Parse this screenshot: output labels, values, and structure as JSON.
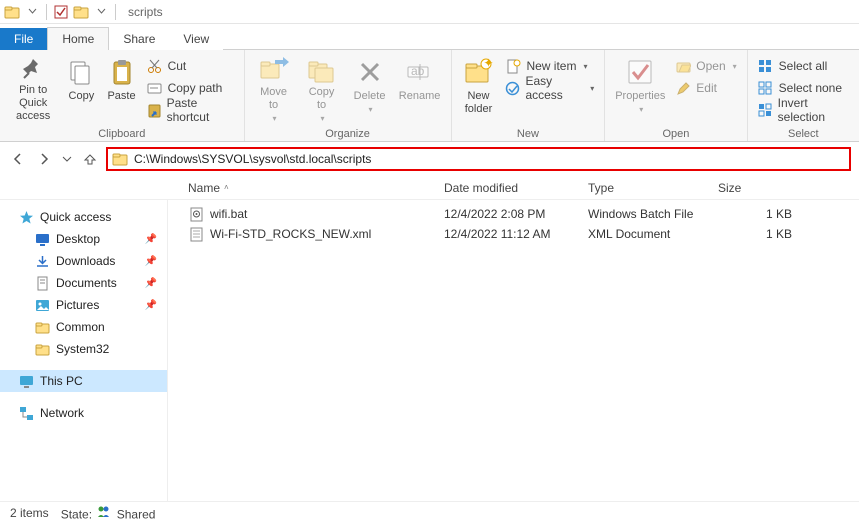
{
  "titlebar": {
    "title": "scripts"
  },
  "tabs": {
    "file": "File",
    "home": "Home",
    "share": "Share",
    "view": "View"
  },
  "ribbon": {
    "clipboard": {
      "label": "Clipboard",
      "pin": "Pin to Quick\naccess",
      "copy": "Copy",
      "paste": "Paste",
      "cut": "Cut",
      "copypath": "Copy path",
      "pasteshortcut": "Paste shortcut"
    },
    "organize": {
      "label": "Organize",
      "moveto": "Move\nto",
      "copyto": "Copy\nto",
      "delete": "Delete",
      "rename": "Rename"
    },
    "new": {
      "label": "New",
      "newfolder": "New\nfolder",
      "newitem": "New item",
      "easyaccess": "Easy access"
    },
    "open": {
      "label": "Open",
      "properties": "Properties",
      "open": "Open",
      "edit": "Edit"
    },
    "select": {
      "label": "Select",
      "selectall": "Select all",
      "selectnone": "Select none",
      "invert": "Invert selection"
    }
  },
  "address": {
    "path": "C:\\Windows\\SYSVOL\\sysvol\\std.local\\scripts"
  },
  "columns": {
    "name": "Name",
    "date": "Date modified",
    "type": "Type",
    "size": "Size",
    "widths": {
      "name": 256,
      "date": 144,
      "type": 130,
      "size": 90
    }
  },
  "nav": {
    "quick": "Quick access",
    "desktop": "Desktop",
    "downloads": "Downloads",
    "documents": "Documents",
    "pictures": "Pictures",
    "common": "Common",
    "system32": "System32",
    "thispc": "This PC",
    "network": "Network"
  },
  "files": [
    {
      "icon": "bat",
      "name": "wifi.bat",
      "date": "12/4/2022 2:08 PM",
      "type": "Windows Batch File",
      "size": "1 KB"
    },
    {
      "icon": "xml",
      "name": "Wi-Fi-STD_ROCKS_NEW.xml",
      "date": "12/4/2022 11:12 AM",
      "type": "XML Document",
      "size": "1 KB"
    }
  ],
  "status": {
    "items": "2 items",
    "state_label": "State:",
    "state_value": "Shared"
  }
}
